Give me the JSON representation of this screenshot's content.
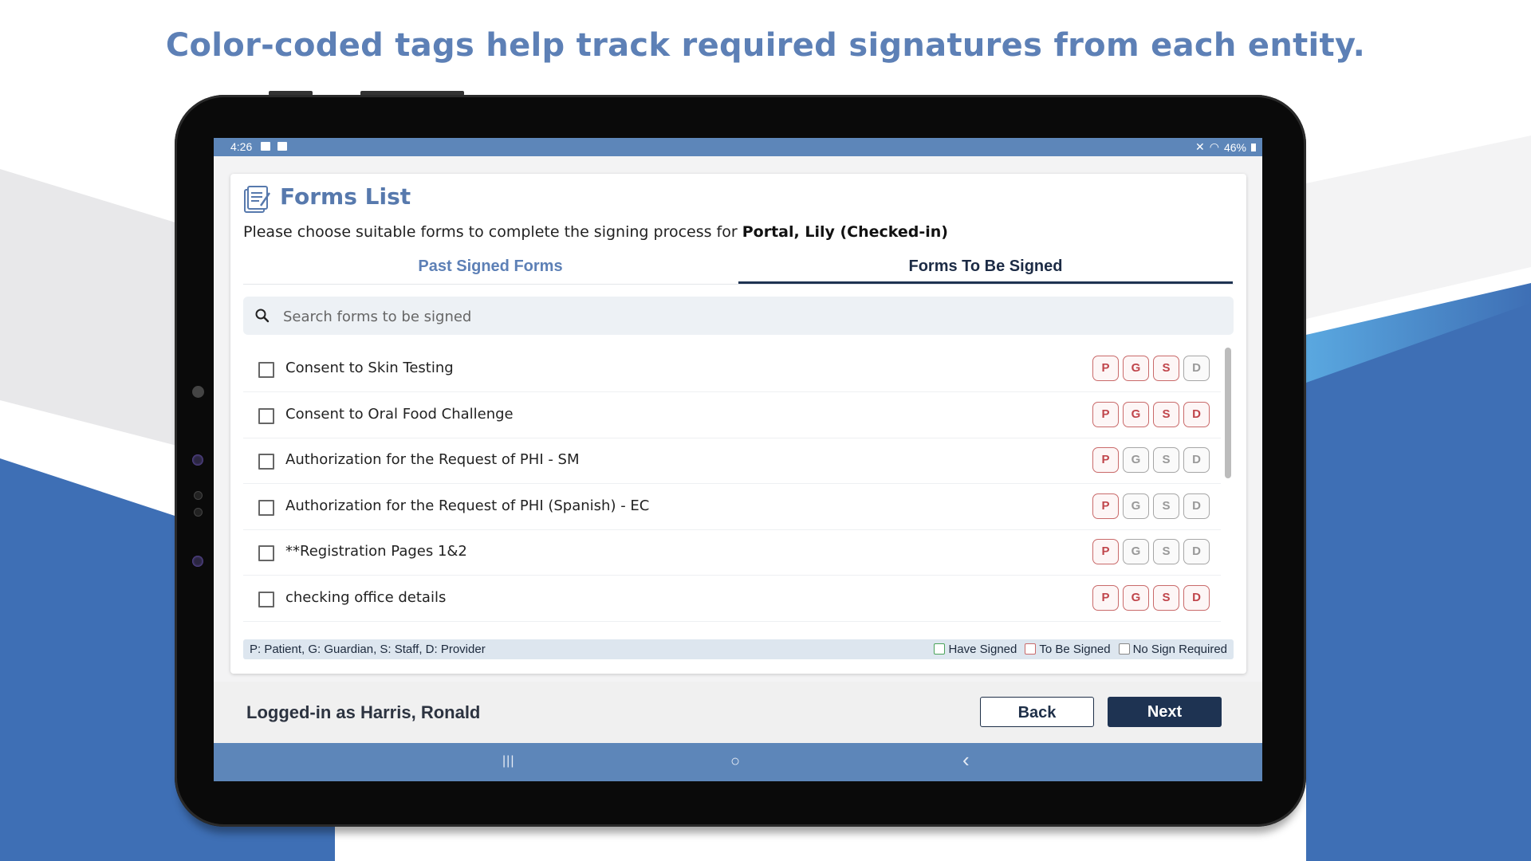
{
  "headline": "Color-coded tags help track required signatures from each entity.",
  "status_bar": {
    "time": "4:26",
    "left_icons": [
      "image-notification-icon",
      "checkbox-notification-icon"
    ],
    "right_icons": [
      "mute-icon",
      "wifi-icon"
    ],
    "battery": "46%"
  },
  "page": {
    "title": "Forms List",
    "title_icon": "form-document-icon",
    "subtitle_prefix": "Please choose suitable forms to complete the signing process for",
    "patient": "Portal, Lily (Checked-in)"
  },
  "tabs": [
    {
      "label": "Past Signed Forms",
      "active": false
    },
    {
      "label": "Forms To Be Signed",
      "active": true
    }
  ],
  "search": {
    "placeholder": "Search forms to be signed",
    "value": ""
  },
  "forms": [
    {
      "name": "Consent to Skin Testing",
      "checked": false,
      "tags": {
        "P": "to_be_signed",
        "G": "to_be_signed",
        "S": "to_be_signed",
        "D": "no_sign_required"
      }
    },
    {
      "name": "Consent to Oral Food Challenge",
      "checked": false,
      "tags": {
        "P": "to_be_signed",
        "G": "to_be_signed",
        "S": "to_be_signed",
        "D": "to_be_signed"
      }
    },
    {
      "name": "Authorization for the Request of PHI - SM",
      "checked": false,
      "tags": {
        "P": "to_be_signed",
        "G": "no_sign_required",
        "S": "no_sign_required",
        "D": "no_sign_required"
      }
    },
    {
      "name": "Authorization for the Request of PHI (Spanish) - EC",
      "checked": false,
      "tags": {
        "P": "to_be_signed",
        "G": "no_sign_required",
        "S": "no_sign_required",
        "D": "no_sign_required"
      }
    },
    {
      "name": "**Registration Pages 1&2",
      "checked": false,
      "tags": {
        "P": "to_be_signed",
        "G": "no_sign_required",
        "S": "no_sign_required",
        "D": "no_sign_required"
      }
    },
    {
      "name": "checking office details",
      "checked": false,
      "tags": {
        "P": "to_be_signed",
        "G": "to_be_signed",
        "S": "to_be_signed",
        "D": "to_be_signed"
      }
    }
  ],
  "tag_order": [
    "P",
    "G",
    "S",
    "D"
  ],
  "legend": {
    "roles": "P: Patient, G: Guardian, S: Staff, D: Provider",
    "have_signed": "Have Signed",
    "to_be_signed": "To Be Signed",
    "no_sign_required": "No Sign Required"
  },
  "colors": {
    "have_signed": "#4aa35a",
    "to_be_signed": "#c96a6a",
    "no_sign_required": "#a6a6a6",
    "accent": "#5d80b6",
    "primary_button": "#1e3352"
  },
  "footer": {
    "logged_in": "Logged-in as Harris, Ronald",
    "back_label": "Back",
    "next_label": "Next"
  },
  "nav_bar": {
    "recents": "|||",
    "home": "○",
    "back": "‹"
  }
}
